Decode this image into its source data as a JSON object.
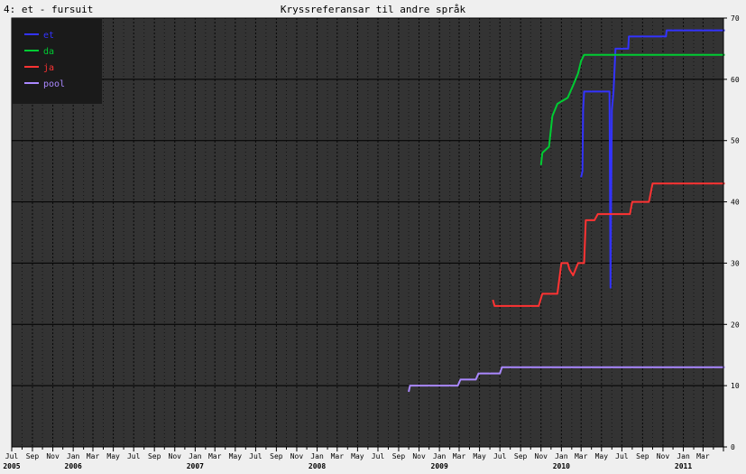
{
  "header": {
    "left_text": "4: et - fursuit",
    "title": "Kryssreferansar til andre språk"
  },
  "chart_data": {
    "type": "line",
    "title": "Kryssreferansar til andre språk",
    "xlabel": "",
    "ylabel": "",
    "ylim": [
      0,
      70
    ],
    "y_ticks": [
      0,
      10,
      20,
      30,
      40,
      50,
      60,
      70
    ],
    "x_range": [
      "2005-07",
      "2011-05"
    ],
    "x_tick_labels": [
      "Jul",
      "Sep",
      "Nov",
      "Jan",
      "Mar",
      "May",
      "Jul",
      "Sep",
      "Nov",
      "Jan",
      "Mar",
      "May",
      "Jul",
      "Sep",
      "Nov",
      "Jan",
      "Mar",
      "May",
      "Jul",
      "Sep",
      "Nov",
      "Jan",
      "Mar",
      "May",
      "Jul",
      "Sep",
      "Nov",
      "Jan",
      "Mar",
      "May",
      "Jul",
      "Sep",
      "Nov",
      "Jan",
      "Mar"
    ],
    "year_labels": [
      "2005",
      "2006",
      "2007",
      "2008",
      "2009",
      "2010",
      "2011"
    ],
    "grid": true,
    "background": "#333333",
    "legend_position": "top-left",
    "series": [
      {
        "name": "et",
        "color": "#3333ff",
        "points": [
          [
            "2010-03-01",
            44
          ],
          [
            "2010-03-05",
            45
          ],
          [
            "2010-03-07",
            55
          ],
          [
            "2010-03-10",
            58
          ],
          [
            "2010-05-25",
            58
          ],
          [
            "2010-05-28",
            26
          ],
          [
            "2010-06-01",
            55
          ],
          [
            "2010-06-06",
            58
          ],
          [
            "2010-06-12",
            65
          ],
          [
            "2010-07-20",
            65
          ],
          [
            "2010-07-22",
            67
          ],
          [
            "2010-11-10",
            67
          ],
          [
            "2010-11-12",
            68
          ],
          [
            "2011-05-05",
            68
          ]
        ]
      },
      {
        "name": "da",
        "color": "#00cc33",
        "points": [
          [
            "2009-11-01",
            46
          ],
          [
            "2009-11-05",
            48
          ],
          [
            "2009-11-25",
            49
          ],
          [
            "2009-12-05",
            54
          ],
          [
            "2009-12-20",
            56
          ],
          [
            "2010-01-20",
            57
          ],
          [
            "2010-02-05",
            59
          ],
          [
            "2010-02-20",
            61
          ],
          [
            "2010-03-01",
            63
          ],
          [
            "2010-03-10",
            64
          ],
          [
            "2011-05-05",
            64
          ]
        ]
      },
      {
        "name": "ja",
        "color": "#ff3333",
        "points": [
          [
            "2009-06-10",
            24
          ],
          [
            "2009-06-15",
            23
          ],
          [
            "2009-10-25",
            23
          ],
          [
            "2009-11-05",
            25
          ],
          [
            "2009-12-20",
            25
          ],
          [
            "2010-01-01",
            30
          ],
          [
            "2010-01-20",
            30
          ],
          [
            "2010-01-25",
            29
          ],
          [
            "2010-02-05",
            28
          ],
          [
            "2010-02-20",
            30
          ],
          [
            "2010-03-10",
            30
          ],
          [
            "2010-03-15",
            37
          ],
          [
            "2010-04-10",
            37
          ],
          [
            "2010-04-20",
            38
          ],
          [
            "2010-07-25",
            38
          ],
          [
            "2010-08-01",
            40
          ],
          [
            "2010-09-20",
            40
          ],
          [
            "2010-10-01",
            43
          ],
          [
            "2011-05-05",
            43
          ]
        ]
      },
      {
        "name": "pool",
        "color": "#aa88ff",
        "points": [
          [
            "2008-10-01",
            9
          ],
          [
            "2008-10-05",
            10
          ],
          [
            "2009-02-25",
            10
          ],
          [
            "2009-03-05",
            11
          ],
          [
            "2009-04-20",
            11
          ],
          [
            "2009-04-28",
            12
          ],
          [
            "2009-07-01",
            12
          ],
          [
            "2009-07-07",
            13
          ],
          [
            "2011-05-05",
            13
          ]
        ]
      }
    ]
  }
}
